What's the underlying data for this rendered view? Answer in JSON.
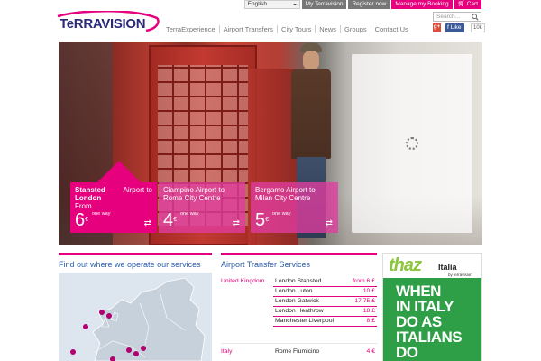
{
  "topbar": {
    "language": "English",
    "my_terravision": "My Terravision",
    "register": "Register now",
    "manage_booking": "Manage my Booking",
    "cart": "Cart"
  },
  "brand": {
    "logo_text": "TeRRAVISION"
  },
  "nav": [
    "TerraExperience",
    "Airport Transfers",
    "City Tours",
    "News",
    "Groups",
    "Contact Us"
  ],
  "search": {
    "placeholder": "Search..."
  },
  "social": {
    "gplus": "g+",
    "fb_like": "Like",
    "fb_count": "10k"
  },
  "hero": {
    "offers": [
      {
        "origin": "Stansted London",
        "dest": "Airport to",
        "from": "From",
        "price": "6",
        "currency": "€",
        "note": "one way"
      },
      {
        "title": "Ciampino Airport to Rome City Centre",
        "price": "4",
        "currency": "€",
        "note": "one way"
      },
      {
        "title": "Bergamo Airport to Milan City Centre",
        "price": "5",
        "currency": "€",
        "note": "one way"
      }
    ]
  },
  "sections": {
    "map_title": "Find out where we operate our services",
    "transfers_title": "Airport Transfer Services"
  },
  "transfers": [
    {
      "country": "United Kingdom",
      "dest": "London Stansted",
      "price": "from 6 £"
    },
    {
      "country": "",
      "dest": "London Luton",
      "price": "10 £"
    },
    {
      "country": "",
      "dest": "London Gatwick",
      "price": "17.75 £"
    },
    {
      "country": "",
      "dest": "London Heathrow",
      "price": "18 £"
    },
    {
      "country": "",
      "dest": "Manchester Liverpool",
      "price": "8 £"
    },
    {
      "country": "Italy",
      "dest": "Rome Fiumicino",
      "price": "4 €"
    }
  ],
  "ad": {
    "logo": "thaz",
    "italia": "Italia",
    "by": "by terravision",
    "lines": [
      "WHEN",
      "IN ITALY",
      "DO AS",
      "ITALIANS",
      "DO"
    ]
  },
  "colors": {
    "brand_pink": "#e6007e",
    "brand_navy": "#2b2a7a",
    "link_blue": "#2b5ea7",
    "ad_green": "#2e9e47"
  }
}
